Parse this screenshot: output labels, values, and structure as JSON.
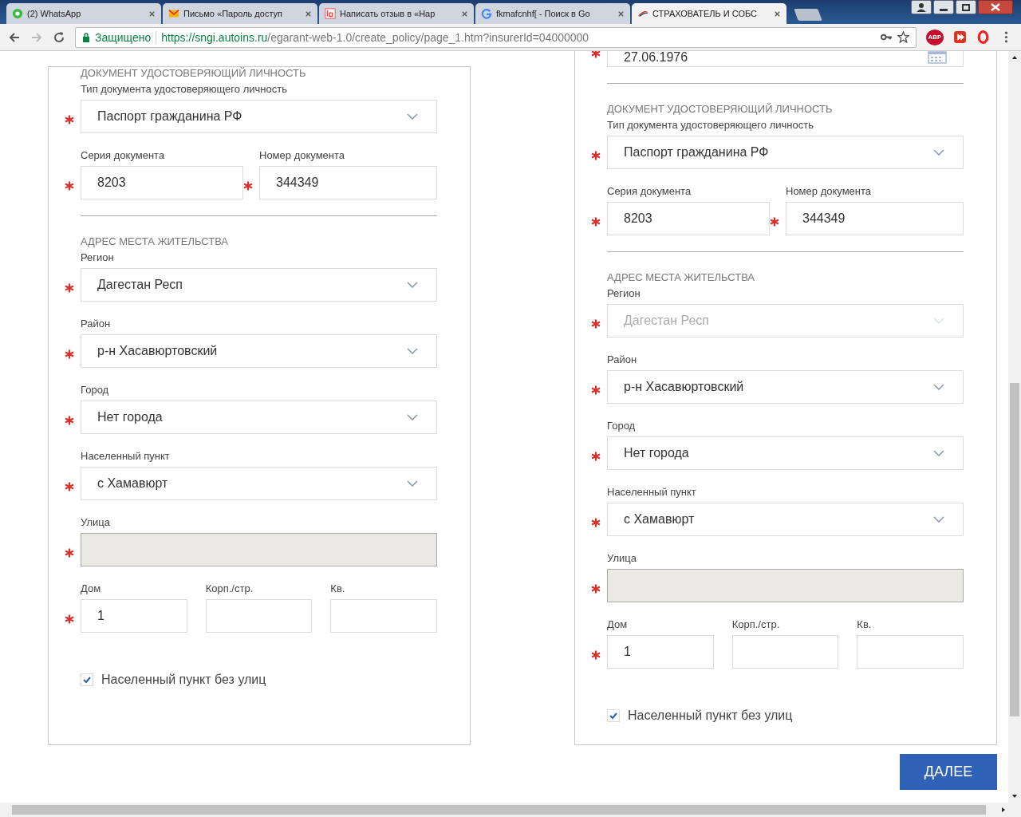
{
  "browser": {
    "tabs": [
      {
        "title": "(2) WhatsApp",
        "kind": "chat",
        "selected": false
      },
      {
        "title": "Письмо «Пароль доступ",
        "kind": "mail",
        "selected": false
      },
      {
        "title": "Написать отзыв в «Нар",
        "kind": "review",
        "selected": false
      },
      {
        "title": "fkmafcnhf[ - Поиск в Go",
        "kind": "search",
        "selected": false
      },
      {
        "title": "СТРАХОВАТЕЛЬ И СОБС",
        "kind": "site",
        "selected": true
      }
    ],
    "security_label": "Защищено",
    "url_origin": "https://sngi.autoins.ru",
    "url_path": "/egarant-web-1.0/create_policy/page_1.htm?insurerId=04000000",
    "adblock_label": "ABP"
  },
  "panels": [
    {
      "document": {
        "heading": "ДОКУМЕНТ УДОСТОВЕРЯЮЩИЙ ЛИЧНОСТЬ",
        "type": {
          "label": "Тип документа удостоверяющего личность",
          "value": "Паспорт гражданина РФ",
          "required": true,
          "disabled": false
        },
        "series": {
          "label": "Серия документа",
          "value": "8203",
          "required": true
        },
        "number": {
          "label": "Номер документа",
          "value": "344349",
          "required": true
        }
      },
      "address": {
        "heading": "АДРЕС МЕСТА ЖИТЕЛЬСТВА",
        "fields": [
          {
            "kind": "select",
            "label": "Регион",
            "value": "Дагестан Респ",
            "required": true,
            "disabled": false
          },
          {
            "kind": "select",
            "label": "Район",
            "value": "р-н Хасавюртовский",
            "required": true,
            "disabled": false
          },
          {
            "kind": "select",
            "label": "Город",
            "value": "Нет города",
            "required": true,
            "disabled": false
          },
          {
            "kind": "select",
            "label": "Населенный пункт",
            "value": "с Хамавюрт",
            "required": true,
            "disabled": false
          },
          {
            "kind": "text",
            "label": "Улица",
            "required": true,
            "disabled": true
          }
        ],
        "house": [
          {
            "label": "Дом",
            "value": "1",
            "required": true
          },
          {
            "label": "Корп./стр.",
            "required": false
          },
          {
            "label": "Кв.",
            "required": false
          }
        ]
      },
      "no_streets": {
        "label": "Населенный пункт без улиц",
        "checked": true
      }
    },
    {
      "birth_date": {
        "value": "27.06.1976",
        "required": true
      },
      "document": {
        "heading": "ДОКУМЕНТ УДОСТОВЕРЯЮЩИЙ ЛИЧНОСТЬ",
        "type": {
          "label": "Тип документа удостоверяющего личность",
          "value": "Паспорт гражданина РФ",
          "required": true,
          "disabled": false
        },
        "series": {
          "label": "Серия документа",
          "value": "8203",
          "required": true
        },
        "number": {
          "label": "Номер документа",
          "value": "344349",
          "required": true
        }
      },
      "address": {
        "heading": "АДРЕС МЕСТА ЖИТЕЛЬСТВА",
        "fields": [
          {
            "kind": "select",
            "label": "Регион",
            "value": "Дагестан Респ",
            "required": true,
            "disabled": true
          },
          {
            "kind": "select",
            "label": "Район",
            "value": "р-н Хасавюртовский",
            "required": true,
            "disabled": false
          },
          {
            "kind": "select",
            "label": "Город",
            "value": "Нет города",
            "required": true,
            "disabled": false
          },
          {
            "kind": "select",
            "label": "Населенный пункт",
            "value": "с Хамавюрт",
            "required": true,
            "disabled": false
          },
          {
            "kind": "text",
            "label": "Улица",
            "required": true,
            "disabled": true
          }
        ],
        "house": [
          {
            "label": "Дом",
            "value": "1",
            "required": true
          },
          {
            "label": "Корп./стр.",
            "required": false
          },
          {
            "label": "Кв.",
            "required": false
          }
        ]
      },
      "no_streets": {
        "label": "Населенный пункт без улиц",
        "checked": true
      }
    }
  ],
  "next_button": "ДАЛЕЕ"
}
